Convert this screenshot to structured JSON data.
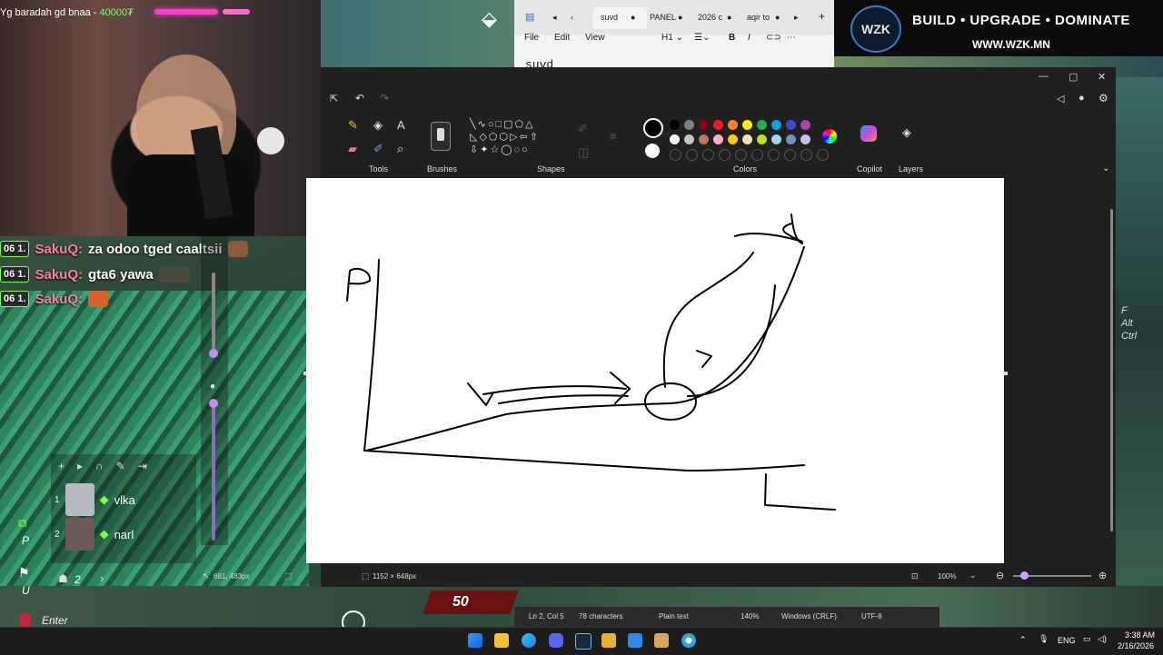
{
  "stream": {
    "cam_caption": "Yg baradah gd bnaa - ",
    "cam_amount": "40000₮",
    "chat": [
      {
        "badge": "06 1.",
        "user": "SakuQ:",
        "msg": "za odoo tged caaltsii"
      },
      {
        "badge": "06 1.",
        "user": "SakuQ:",
        "msg": "gta6 yawa"
      },
      {
        "badge": "06 1.",
        "user": "SakuQ:",
        "msg": ""
      }
    ],
    "voice_users": [
      {
        "num": "1",
        "name": "vlka"
      },
      {
        "num": "2",
        "name": "narl"
      }
    ],
    "side_keys": [
      "P",
      "U"
    ],
    "enter_label": "Enter",
    "user_count": "2",
    "score": "50"
  },
  "banner": {
    "logo": "WZK",
    "slogan": "BUILD • UPGRADE • DOMINATE",
    "url": "WWW.WZK.MN"
  },
  "notepad": {
    "tabs": [
      "suvd",
      "PANEL",
      "2026 c",
      "aqir to"
    ],
    "active_tab": "suvd",
    "menu": [
      "File",
      "Edit",
      "View"
    ],
    "heading_select": "H1",
    "text": "suvd",
    "status": {
      "position": "Ln 2, Col 5",
      "chars": "78 characters",
      "format": "Plain text",
      "zoom": "140%",
      "eol": "Windows (CRLF)",
      "encoding": "UTF-8"
    }
  },
  "paint": {
    "ribbon_labels": {
      "tools": "Tools",
      "brushes": "Brushes",
      "shapes": "Shapes",
      "colors": "Colors",
      "copilot": "Copilot",
      "layers": "Layers"
    },
    "colors_row1": [
      "#000000",
      "#7f7f7f",
      "#880015",
      "#ed1c24",
      "#ff7f27",
      "#fff200",
      "#22b14c",
      "#00a2e8",
      "#3f48cc",
      "#a349a4"
    ],
    "colors_row2": [
      "#ffffff",
      "#c3c3c3",
      "#b97a57",
      "#ffaec9",
      "#ffc90e",
      "#efe4b0",
      "#b5e61d",
      "#99d9ea",
      "#7092be",
      "#c8bfe7"
    ],
    "status": {
      "cursor": "681, 483px",
      "canvas_size": "1152 × 648px",
      "zoom": "100%"
    }
  },
  "taskbar": {
    "lang": "ENG",
    "time": "3:38 AM",
    "date": "2/16/2026"
  }
}
